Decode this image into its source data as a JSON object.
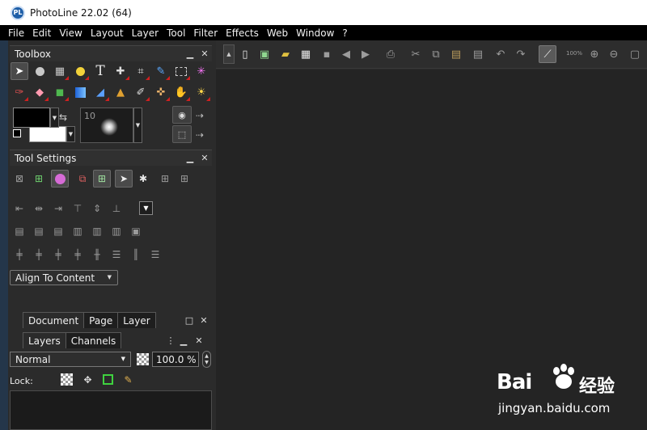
{
  "window": {
    "title": "PhotoLine 22.02 (64)",
    "logo_text": "PL"
  },
  "menu": [
    "File",
    "Edit",
    "View",
    "Layout",
    "Layer",
    "Tool",
    "Filter",
    "Effects",
    "Web",
    "Window",
    "?"
  ],
  "toolbox": {
    "title": "Toolbox",
    "min_glyph": "▁",
    "close_glyph": "✕",
    "brush_size": "10"
  },
  "tool_settings": {
    "title": "Tool Settings",
    "align_mode": "Align To Content"
  },
  "doc_tabs": [
    "Document",
    "Page",
    "Layer"
  ],
  "layers_panel": {
    "tabs": [
      "Layers",
      "Channels"
    ],
    "blend_mode": "Normal",
    "opacity": "100.0 %",
    "lock_label": "Lock:"
  },
  "toolbar": {
    "zoom": "100%"
  },
  "watermark": {
    "brand": "Bai",
    "brand_cn": "经验",
    "url": "jingyan.baidu.com"
  },
  "colors": {
    "titlebar": "#ffffff",
    "menubar": "#000000",
    "panel": "#2b2b2b",
    "canvas": "#242424"
  }
}
